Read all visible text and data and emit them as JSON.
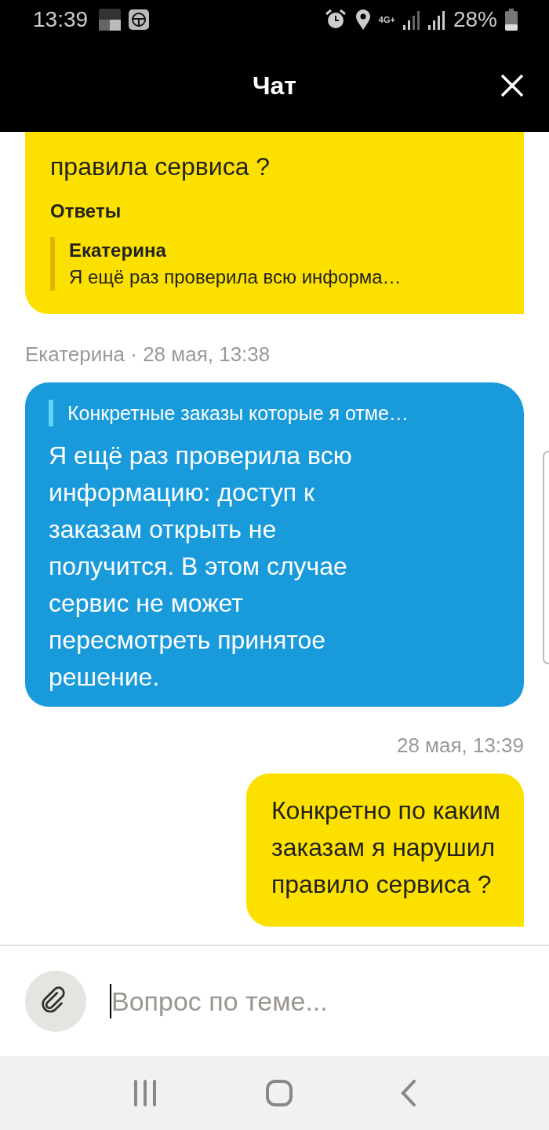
{
  "status_bar": {
    "time": "13:39",
    "network_type": "4G+",
    "battery": "28%"
  },
  "header": {
    "title": "Чат"
  },
  "messages": [
    {
      "kind": "outgoing",
      "text": "правила сервиса ?",
      "replies_label": "Ответы",
      "reply": {
        "author": "Екатерина",
        "text": "Я ещё раз проверила всю информа…"
      }
    },
    {
      "kind": "incoming",
      "meta": "Екатерина · 28 мая, 13:38",
      "quote": "Конкретные заказы которые я отме…",
      "text": "Я ещё раз проверила всю\nинформацию: доступ к\nзаказам открыть не\nполучится. В этом случае\nсервис не может\nпересмотреть принятое\nрешение."
    },
    {
      "kind": "outgoing",
      "meta": "28 мая, 13:39",
      "text": "Конкретно по каким\nзаказам я нарушил\nправило сервиса ?"
    }
  ],
  "composer": {
    "placeholder": "Вопрос по теме..."
  }
}
